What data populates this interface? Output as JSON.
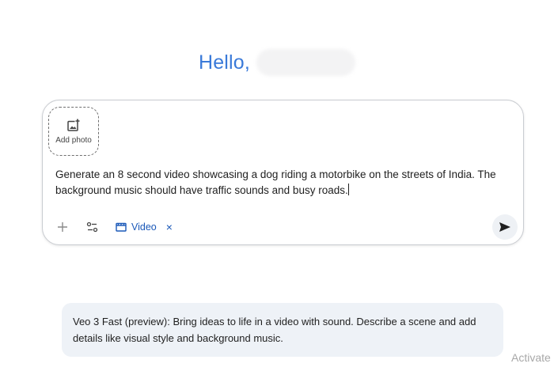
{
  "greeting": {
    "text": "Hello,"
  },
  "composer": {
    "add_photo_label": "Add photo",
    "prompt_text": "Generate an 8 second video showcasing a dog riding a motorbike on the streets of India. The background music should have traffic sounds and busy roads.",
    "toolbar": {
      "add_icon": "plus-icon",
      "tools_icon": "tune-icon",
      "video_chip_label": "Video",
      "video_chip_icon": "clapperboard-icon",
      "video_chip_close": "×"
    },
    "send_icon": "send-icon"
  },
  "tip": {
    "text": "Veo 3 Fast (preview): Bring ideas to life in a video with sound. Describe a scene and add details like visual style and background music."
  },
  "watermark": {
    "text": "Activate"
  },
  "colors": {
    "greeting": "#3a7ad9",
    "chip": "#1a58b8",
    "tip_bg": "#eef2f7"
  }
}
